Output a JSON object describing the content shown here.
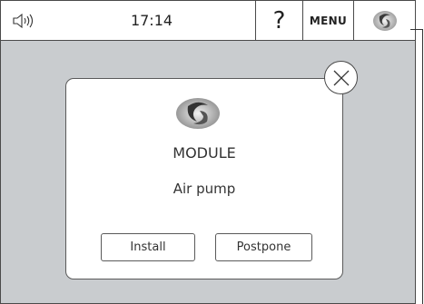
{
  "topbar": {
    "sound_icon": "speaker-icon",
    "time": "17:14",
    "help_label": "?",
    "menu_label": "MENU",
    "module_icon": "module-fan-icon"
  },
  "dialog": {
    "icon": "module-fan-icon",
    "title": "MODULE",
    "subtitle": "Air pump",
    "install_label": "Install",
    "postpone_label": "Postpone",
    "close_icon": "close-icon"
  },
  "colors": {
    "background": "#c9cccf",
    "panel": "#ffffff",
    "border": "#4a4a4a"
  }
}
